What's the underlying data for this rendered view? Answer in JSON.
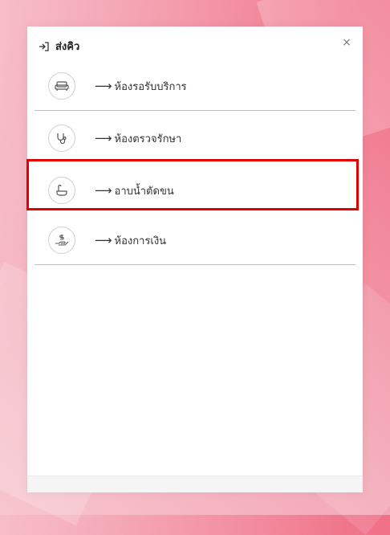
{
  "header": {
    "title": "ส่งคิว",
    "close_symbol": "×"
  },
  "rooms": [
    {
      "label": "ห้องรอรับบริการ",
      "arrow": "⟶",
      "icon": "sofa-icon"
    },
    {
      "label": "ห้องตรวจรักษา",
      "arrow": "⟶",
      "icon": "stethoscope-icon"
    },
    {
      "label": "อาบน้ำตัดขน",
      "arrow": "⟶",
      "icon": "bathtub-icon",
      "highlighted": true
    },
    {
      "label": "ห้องการเงิน",
      "arrow": "⟶",
      "icon": "payment-hand-icon"
    }
  ],
  "colors": {
    "highlight": "#e00000",
    "panel": "#ffffff",
    "background": "#f3a6b5"
  }
}
